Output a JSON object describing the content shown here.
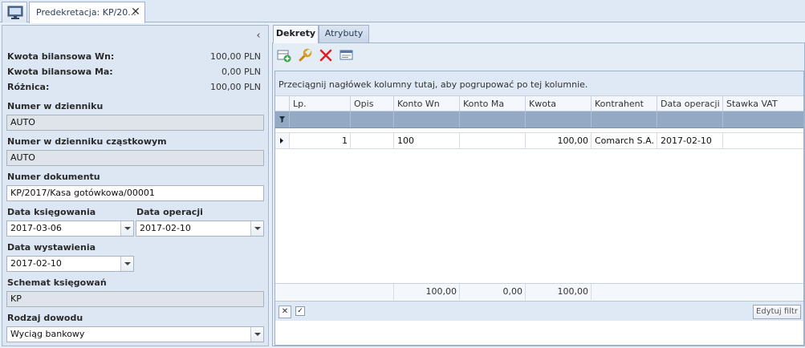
{
  "window": {
    "doc_tab_title": "Predekretacja: KP/20...",
    "close_glyph": "✕"
  },
  "left_panel": {
    "collapse_glyph": "‹",
    "summary": [
      {
        "label": "Kwota bilansowa Wn:",
        "value": "100,00 PLN"
      },
      {
        "label": "Kwota bilansowa Ma:",
        "value": "0,00 PLN"
      },
      {
        "label": "Różnica:",
        "value": "100,00 PLN"
      }
    ],
    "journal_number": {
      "label": "Numer w dzienniku",
      "value": "AUTO"
    },
    "partial_journal_number": {
      "label": "Numer w dzienniku cząstkowym",
      "value": "AUTO"
    },
    "document_number": {
      "label": "Numer dokumentu",
      "value": "KP/2017/Kasa gotówkowa/00001"
    },
    "posting_date": {
      "label": "Data księgowania",
      "value": "2017-03-06"
    },
    "operation_date": {
      "label": "Data operacji",
      "value": "2017-02-10"
    },
    "issue_date": {
      "label": "Data wystawienia",
      "value": "2017-02-10"
    },
    "posting_scheme": {
      "label": "Schemat księgowań",
      "value": "KP"
    },
    "proof_type": {
      "label": "Rodzaj dowodu",
      "value": "Wyciąg bankowy"
    }
  },
  "right_panel": {
    "tabs": [
      "Dekrety",
      "Atrybuty"
    ],
    "toolbar": {
      "add_icon": "add-record-icon",
      "edit_icon": "wrench-icon",
      "delete_icon": "red-x-icon",
      "view_icon": "view-list-icon"
    },
    "group_hint": "Przeciągnij nagłówek kolumny tutaj, aby pogrupować po tej kolumnie.",
    "columns": [
      "Lp.",
      "Opis",
      "Konto Wn",
      "Konto Ma",
      "Kwota",
      "Kontrahent",
      "Data operacji",
      "Stawka VAT"
    ],
    "rows": [
      {
        "lp": "1",
        "opis": "",
        "konto_wn": "100",
        "konto_ma": "",
        "kwota": "100,00",
        "kontrahent": "Comarch S.A.",
        "data_operacji": "2017-02-10",
        "stawka_vat": ""
      }
    ],
    "totals": {
      "konto_wn": "100,00",
      "konto_ma": "0,00",
      "kwota": "100,00"
    },
    "bottom": {
      "clear_glyph": "✕",
      "check_glyph": "✓",
      "edit_filter": "Edytuj filtr"
    }
  },
  "colors": {
    "accent": "#94a9c4",
    "panel": "#dde7f4",
    "delete": "#e02020"
  }
}
